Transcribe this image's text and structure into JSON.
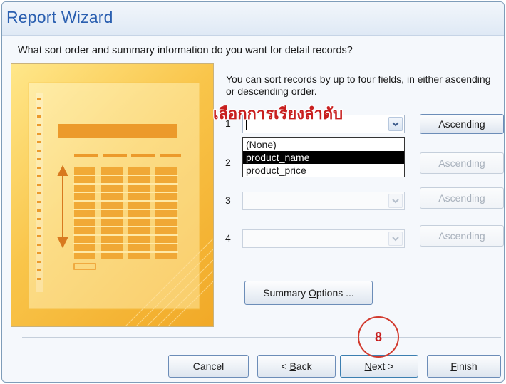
{
  "window": {
    "title": "Report Wizard",
    "question": "What sort order and summary information do you want for detail records?"
  },
  "sort": {
    "hint": "You can sort records by up to four fields, in either ascending or descending order.",
    "annotation": "เลือกการเรียงลำดับ",
    "rows": [
      {
        "num": "1",
        "value": "",
        "order_label": "Ascending",
        "enabled": true
      },
      {
        "num": "2",
        "value": "",
        "order_label": "Ascending",
        "enabled": false
      },
      {
        "num": "3",
        "value": "",
        "order_label": "Ascending",
        "enabled": false
      },
      {
        "num": "4",
        "value": "",
        "order_label": "Ascending",
        "enabled": false
      }
    ],
    "dropdown": {
      "options": [
        "(None)",
        "product_name",
        "product_price"
      ],
      "selected": "product_name"
    }
  },
  "summary_button": {
    "pre": "Summary ",
    "mnemonic": "O",
    "post": "ptions ..."
  },
  "footer": {
    "cancel": {
      "pre": "Cancel",
      "mnemonic": "",
      "post": ""
    },
    "back": {
      "pre": "< ",
      "mnemonic": "B",
      "post": "ack"
    },
    "next": {
      "pre": "",
      "mnemonic": "N",
      "post": "ext >"
    },
    "finish": {
      "pre": "",
      "mnemonic": "F",
      "post": "inish"
    }
  },
  "step_marker": "8",
  "colors": {
    "title": "#2a5fb0",
    "annotation": "#c81e1e",
    "preview_light": "#ffe78a",
    "preview_dark": "#f1a927",
    "selection": "#000000"
  },
  "icons": {
    "dropdown_arrow": "chevron-down-icon",
    "sort_arrow": "double-arrow-icon"
  }
}
